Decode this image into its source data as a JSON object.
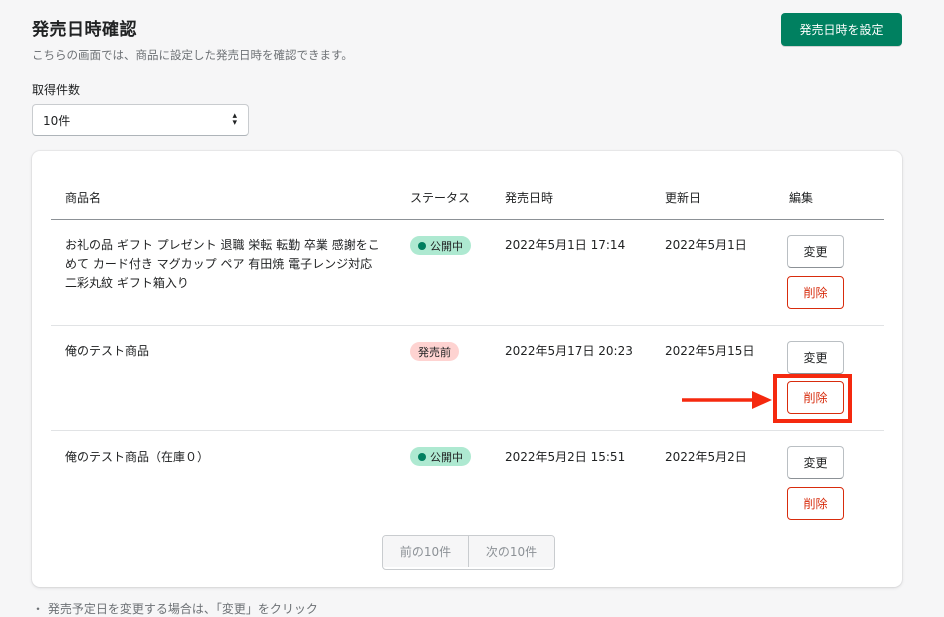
{
  "page": {
    "title": "発売日時確認",
    "subtitle": "こちらの画面では、商品に設定した発売日時を確認できます。",
    "primary_action": "発売日時を設定"
  },
  "count_select": {
    "label": "取得件数",
    "value": "10件"
  },
  "table": {
    "headers": {
      "name": "商品名",
      "status": "ステータス",
      "release": "発売日時",
      "updated": "更新日",
      "edit": "編集"
    },
    "rows": [
      {
        "name": "お礼の品 ギフト プレゼント 退職 栄転 転勤 卒業 感謝をこめて カード付き マグカップ ペア 有田焼 電子レンジ対応 二彩丸紋 ギフト箱入り",
        "status": "公開中",
        "status_type": "success",
        "release": "2022年5月1日 17:14",
        "updated": "2022年5月1日",
        "edit_label": "変更",
        "delete_label": "削除"
      },
      {
        "name": "俺のテスト商品",
        "status": "発売前",
        "status_type": "pending",
        "release": "2022年5月17日 20:23",
        "updated": "2022年5月15日",
        "edit_label": "変更",
        "delete_label": "削除"
      },
      {
        "name": "俺のテスト商品（在庫０）",
        "status": "公開中",
        "status_type": "success",
        "release": "2022年5月2日 15:51",
        "updated": "2022年5月2日",
        "edit_label": "変更",
        "delete_label": "削除"
      }
    ]
  },
  "pagination": {
    "prev": "前の10件",
    "next": "次の10件"
  },
  "footer_note": "・ 発売予定日を変更する場合は、「変更」をクリック",
  "colors": {
    "primary": "#008060",
    "critical": "#d72c0d",
    "annotation": "#f5290f",
    "badge_success": "#aee9d1",
    "badge_pending": "#fed3d1"
  }
}
